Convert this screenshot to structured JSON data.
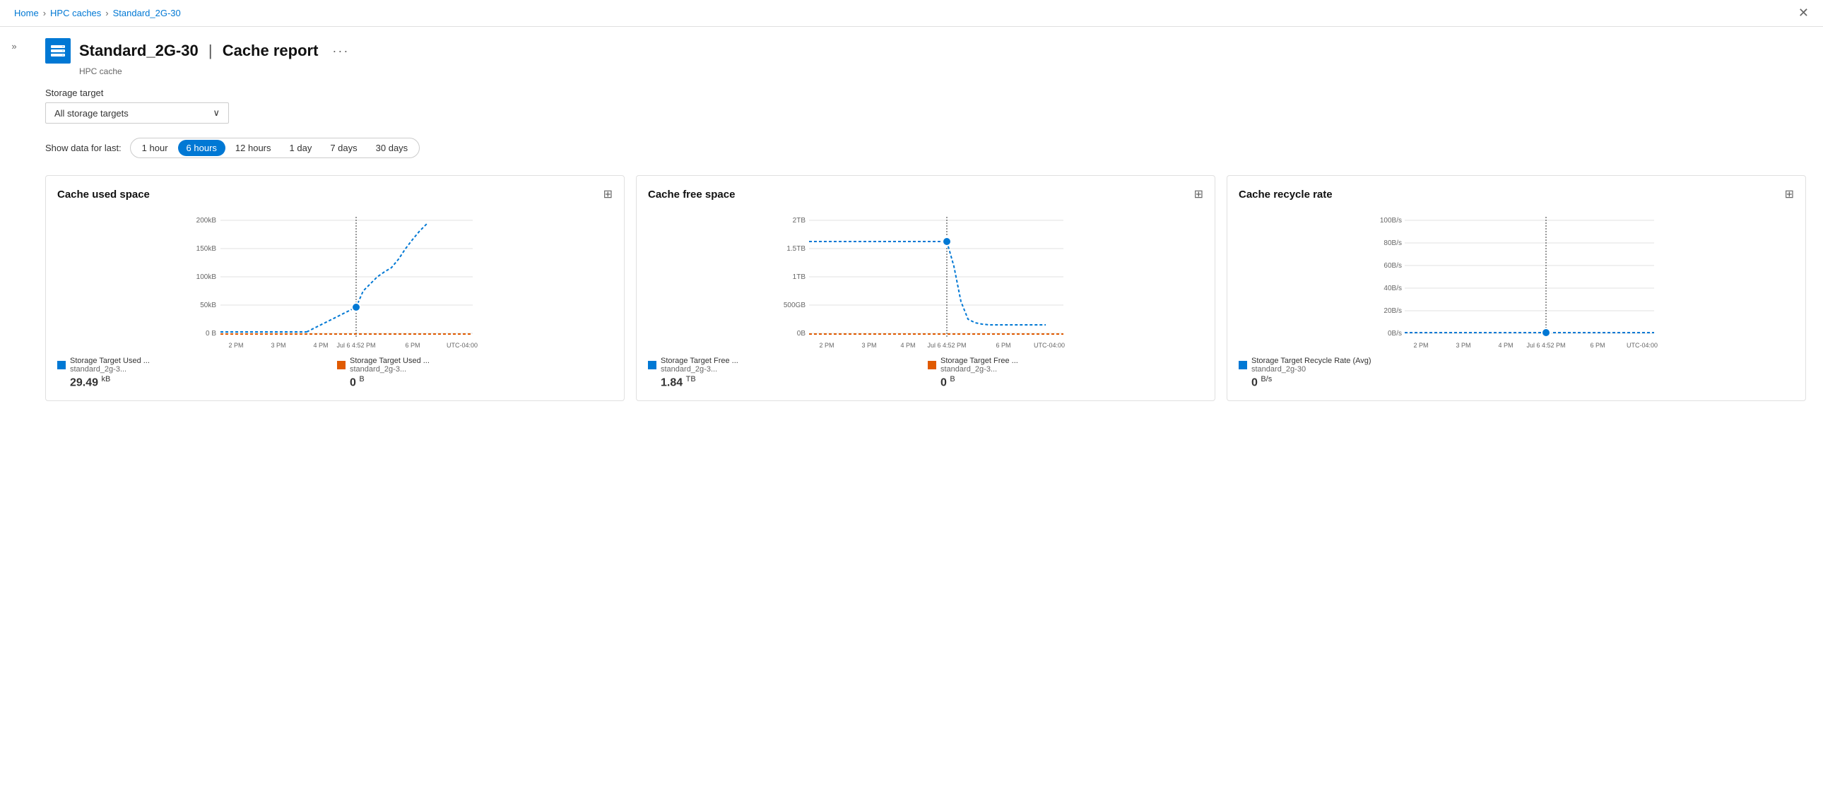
{
  "breadcrumb": {
    "home": "Home",
    "parent": "HPC caches",
    "current": "Standard_2G-30"
  },
  "page": {
    "title": "Standard_2G-30",
    "separator": "|",
    "subtitle_part": "Cache report",
    "resource_type": "HPC cache"
  },
  "sidebar_toggle": "»",
  "filter": {
    "label": "Storage target",
    "selected": "All storage targets"
  },
  "time_filter": {
    "label": "Show data for last:",
    "options": [
      "1 hour",
      "6 hours",
      "12 hours",
      "1 day",
      "7 days",
      "30 days"
    ],
    "active": "6 hours"
  },
  "charts": [
    {
      "id": "cache-used-space",
      "title": "Cache used space",
      "x_labels": [
        "2 PM",
        "3 PM",
        "4 PM",
        "Jul 6 4:52 PM",
        "6 PM",
        "UTC-04:00"
      ],
      "y_labels": [
        "200kB",
        "150kB",
        "100kB",
        "50kB",
        "0 B"
      ],
      "legends": [
        {
          "label": "Storage Target Used ...",
          "sublabel": "standard_2g-3...",
          "color": "#0078d4",
          "value": "29.49",
          "unit": "kB"
        },
        {
          "label": "Storage Target Used ...",
          "sublabel": "standard_2g-3...",
          "color": "#e05a00",
          "value": "0",
          "unit": "B"
        }
      ]
    },
    {
      "id": "cache-free-space",
      "title": "Cache free space",
      "x_labels": [
        "2 PM",
        "3 PM",
        "4 PM",
        "Jul 6 4:52 PM",
        "6 PM",
        "UTC-04:00"
      ],
      "y_labels": [
        "2TB",
        "1.5TB",
        "1TB",
        "500GB",
        "0B"
      ],
      "legends": [
        {
          "label": "Storage Target Free ...",
          "sublabel": "standard_2g-3...",
          "color": "#0078d4",
          "value": "1.84",
          "unit": "TB"
        },
        {
          "label": "Storage Target Free ...",
          "sublabel": "standard_2g-3...",
          "color": "#e05a00",
          "value": "0",
          "unit": "B"
        }
      ]
    },
    {
      "id": "cache-recycle-rate",
      "title": "Cache recycle rate",
      "x_labels": [
        "2 PM",
        "3 PM",
        "4 PM",
        "Jul 6 4:52 PM",
        "6 PM",
        "UTC-04:00"
      ],
      "y_labels": [
        "100B/s",
        "80B/s",
        "60B/s",
        "40B/s",
        "20B/s",
        "0B/s"
      ],
      "legends": [
        {
          "label": "Storage Target Recycle Rate (Avg)",
          "sublabel": "standard_2g-30",
          "color": "#0078d4",
          "value": "0",
          "unit": "B/s"
        }
      ]
    }
  ],
  "icons": {
    "pin": "📌",
    "close": "✕",
    "more": "···",
    "chevron_down": "⌄",
    "double_chevron_right": "»",
    "double_chevron_left": "«"
  }
}
